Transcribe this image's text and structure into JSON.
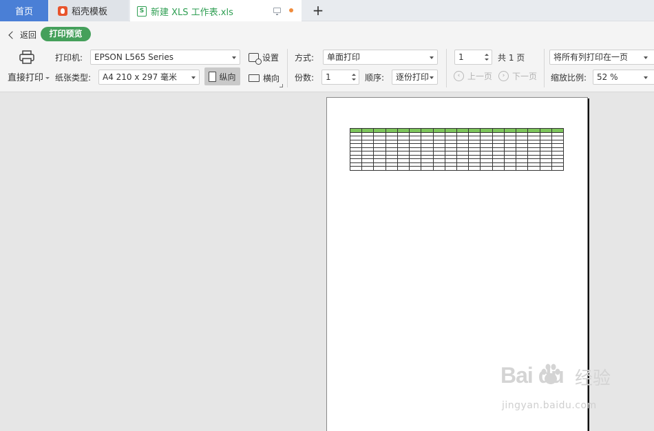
{
  "tabs": {
    "home": "首页",
    "daoke": "稻壳模板",
    "document": "新建 XLS 工作表.xls",
    "new_tab": "+"
  },
  "toolbar": {
    "back_label": "返回",
    "preview_badge": "打印预览",
    "direct_print_label": "直接打印",
    "printer_label": "打印机:",
    "printer_value": "EPSON L565 Series",
    "settings_label": "设置",
    "paper_label": "纸张类型:",
    "paper_value": "A4 210 x 297 毫米",
    "portrait_label": "纵向",
    "landscape_label": "横向",
    "mode_label": "方式:",
    "mode_value": "单面打印",
    "copies_label": "份数:",
    "copies_value": "1",
    "order_label": "顺序:",
    "order_value": "逐份打印",
    "page_value": "1",
    "total_pages": "共 1 页",
    "prev_page": "上一页",
    "next_page": "下一页",
    "fit_value": "将所有列打印在一页",
    "zoom_label": "缩放比例:",
    "zoom_value": "52 %"
  },
  "colors": {
    "home_tab": "#4a7fd6",
    "accent_green": "#45a05b",
    "table_header": "#7dc55b"
  },
  "icons": {
    "printer": "printer-icon",
    "settings": "printer-settings-icon",
    "portrait": "portrait-page-icon",
    "landscape": "landscape-page-icon"
  },
  "watermark": {
    "brand": "Bai du",
    "cn": "经验",
    "url": "jingyan.baidu.com"
  }
}
